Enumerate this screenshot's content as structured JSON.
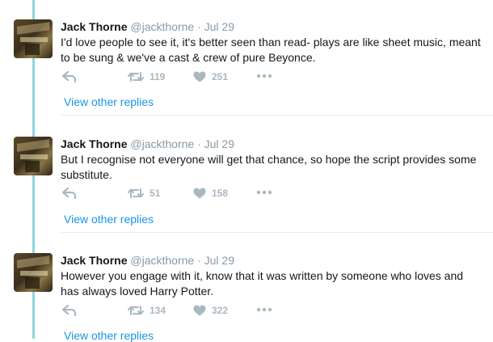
{
  "tweets": [
    {
      "name": "Jack Thorne",
      "handle": "@jackthorne",
      "separator": "·",
      "date": "Jul 29",
      "text": "I'd love people to see it, it's better seen than read- plays are like sheet music, meant to be sung & we've a cast & crew of pure Beyonce.",
      "retweets": "119",
      "likes": "251",
      "view_replies": "View other replies"
    },
    {
      "name": "Jack Thorne",
      "handle": "@jackthorne",
      "separator": "·",
      "date": "Jul 29",
      "text": "But I recognise not everyone will get that chance, so hope the script provides some substitute.",
      "retweets": "51",
      "likes": "158",
      "view_replies": "View other replies"
    },
    {
      "name": "Jack Thorne",
      "handle": "@jackthorne",
      "separator": "·",
      "date": "Jul 29",
      "text": "However you engage with it, know that it was written by someone who loves and has always loved Harry Potter.",
      "retweets": "134",
      "likes": "322",
      "view_replies": "View other replies"
    }
  ],
  "colors": {
    "thread_line": "#8fd3e6",
    "link": "#1b95e0",
    "muted": "#8899a6",
    "icon": "#aab8c2"
  },
  "icons": [
    "reply-icon",
    "retweet-icon",
    "like-icon",
    "more-icon"
  ]
}
